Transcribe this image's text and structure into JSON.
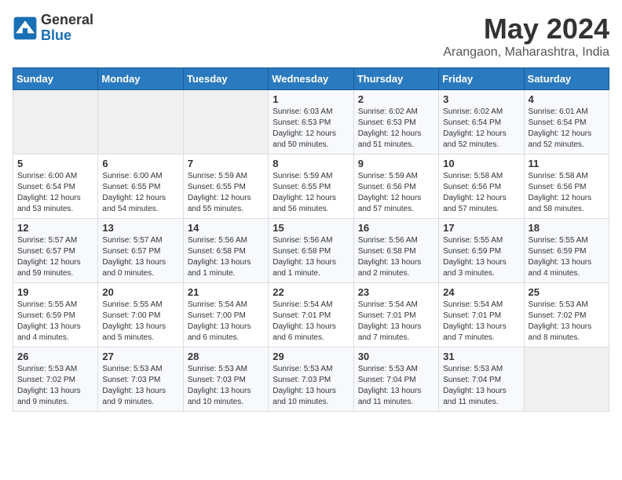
{
  "header": {
    "logo_general": "General",
    "logo_blue": "Blue",
    "month": "May 2024",
    "location": "Arangaon, Maharashtra, India"
  },
  "weekdays": [
    "Sunday",
    "Monday",
    "Tuesday",
    "Wednesday",
    "Thursday",
    "Friday",
    "Saturday"
  ],
  "weeks": [
    [
      {
        "day": "",
        "empty": true
      },
      {
        "day": "",
        "empty": true
      },
      {
        "day": "",
        "empty": true
      },
      {
        "day": "1",
        "lines": [
          "Sunrise: 6:03 AM",
          "Sunset: 6:53 PM",
          "Daylight: 12 hours",
          "and 50 minutes."
        ]
      },
      {
        "day": "2",
        "lines": [
          "Sunrise: 6:02 AM",
          "Sunset: 6:53 PM",
          "Daylight: 12 hours",
          "and 51 minutes."
        ]
      },
      {
        "day": "3",
        "lines": [
          "Sunrise: 6:02 AM",
          "Sunset: 6:54 PM",
          "Daylight: 12 hours",
          "and 52 minutes."
        ]
      },
      {
        "day": "4",
        "lines": [
          "Sunrise: 6:01 AM",
          "Sunset: 6:54 PM",
          "Daylight: 12 hours",
          "and 52 minutes."
        ]
      }
    ],
    [
      {
        "day": "5",
        "lines": [
          "Sunrise: 6:00 AM",
          "Sunset: 6:54 PM",
          "Daylight: 12 hours",
          "and 53 minutes."
        ]
      },
      {
        "day": "6",
        "lines": [
          "Sunrise: 6:00 AM",
          "Sunset: 6:55 PM",
          "Daylight: 12 hours",
          "and 54 minutes."
        ]
      },
      {
        "day": "7",
        "lines": [
          "Sunrise: 5:59 AM",
          "Sunset: 6:55 PM",
          "Daylight: 12 hours",
          "and 55 minutes."
        ]
      },
      {
        "day": "8",
        "lines": [
          "Sunrise: 5:59 AM",
          "Sunset: 6:55 PM",
          "Daylight: 12 hours",
          "and 56 minutes."
        ]
      },
      {
        "day": "9",
        "lines": [
          "Sunrise: 5:59 AM",
          "Sunset: 6:56 PM",
          "Daylight: 12 hours",
          "and 57 minutes."
        ]
      },
      {
        "day": "10",
        "lines": [
          "Sunrise: 5:58 AM",
          "Sunset: 6:56 PM",
          "Daylight: 12 hours",
          "and 57 minutes."
        ]
      },
      {
        "day": "11",
        "lines": [
          "Sunrise: 5:58 AM",
          "Sunset: 6:56 PM",
          "Daylight: 12 hours",
          "and 58 minutes."
        ]
      }
    ],
    [
      {
        "day": "12",
        "lines": [
          "Sunrise: 5:57 AM",
          "Sunset: 6:57 PM",
          "Daylight: 12 hours",
          "and 59 minutes."
        ]
      },
      {
        "day": "13",
        "lines": [
          "Sunrise: 5:57 AM",
          "Sunset: 6:57 PM",
          "Daylight: 13 hours",
          "and 0 minutes."
        ]
      },
      {
        "day": "14",
        "lines": [
          "Sunrise: 5:56 AM",
          "Sunset: 6:58 PM",
          "Daylight: 13 hours",
          "and 1 minute."
        ]
      },
      {
        "day": "15",
        "lines": [
          "Sunrise: 5:56 AM",
          "Sunset: 6:58 PM",
          "Daylight: 13 hours",
          "and 1 minute."
        ]
      },
      {
        "day": "16",
        "lines": [
          "Sunrise: 5:56 AM",
          "Sunset: 6:58 PM",
          "Daylight: 13 hours",
          "and 2 minutes."
        ]
      },
      {
        "day": "17",
        "lines": [
          "Sunrise: 5:55 AM",
          "Sunset: 6:59 PM",
          "Daylight: 13 hours",
          "and 3 minutes."
        ]
      },
      {
        "day": "18",
        "lines": [
          "Sunrise: 5:55 AM",
          "Sunset: 6:59 PM",
          "Daylight: 13 hours",
          "and 4 minutes."
        ]
      }
    ],
    [
      {
        "day": "19",
        "lines": [
          "Sunrise: 5:55 AM",
          "Sunset: 6:59 PM",
          "Daylight: 13 hours",
          "and 4 minutes."
        ]
      },
      {
        "day": "20",
        "lines": [
          "Sunrise: 5:55 AM",
          "Sunset: 7:00 PM",
          "Daylight: 13 hours",
          "and 5 minutes."
        ]
      },
      {
        "day": "21",
        "lines": [
          "Sunrise: 5:54 AM",
          "Sunset: 7:00 PM",
          "Daylight: 13 hours",
          "and 6 minutes."
        ]
      },
      {
        "day": "22",
        "lines": [
          "Sunrise: 5:54 AM",
          "Sunset: 7:01 PM",
          "Daylight: 13 hours",
          "and 6 minutes."
        ]
      },
      {
        "day": "23",
        "lines": [
          "Sunrise: 5:54 AM",
          "Sunset: 7:01 PM",
          "Daylight: 13 hours",
          "and 7 minutes."
        ]
      },
      {
        "day": "24",
        "lines": [
          "Sunrise: 5:54 AM",
          "Sunset: 7:01 PM",
          "Daylight: 13 hours",
          "and 7 minutes."
        ]
      },
      {
        "day": "25",
        "lines": [
          "Sunrise: 5:53 AM",
          "Sunset: 7:02 PM",
          "Daylight: 13 hours",
          "and 8 minutes."
        ]
      }
    ],
    [
      {
        "day": "26",
        "lines": [
          "Sunrise: 5:53 AM",
          "Sunset: 7:02 PM",
          "Daylight: 13 hours",
          "and 9 minutes."
        ]
      },
      {
        "day": "27",
        "lines": [
          "Sunrise: 5:53 AM",
          "Sunset: 7:03 PM",
          "Daylight: 13 hours",
          "and 9 minutes."
        ]
      },
      {
        "day": "28",
        "lines": [
          "Sunrise: 5:53 AM",
          "Sunset: 7:03 PM",
          "Daylight: 13 hours",
          "and 10 minutes."
        ]
      },
      {
        "day": "29",
        "lines": [
          "Sunrise: 5:53 AM",
          "Sunset: 7:03 PM",
          "Daylight: 13 hours",
          "and 10 minutes."
        ]
      },
      {
        "day": "30",
        "lines": [
          "Sunrise: 5:53 AM",
          "Sunset: 7:04 PM",
          "Daylight: 13 hours",
          "and 11 minutes."
        ]
      },
      {
        "day": "31",
        "lines": [
          "Sunrise: 5:53 AM",
          "Sunset: 7:04 PM",
          "Daylight: 13 hours",
          "and 11 minutes."
        ]
      },
      {
        "day": "",
        "empty": true
      }
    ]
  ]
}
